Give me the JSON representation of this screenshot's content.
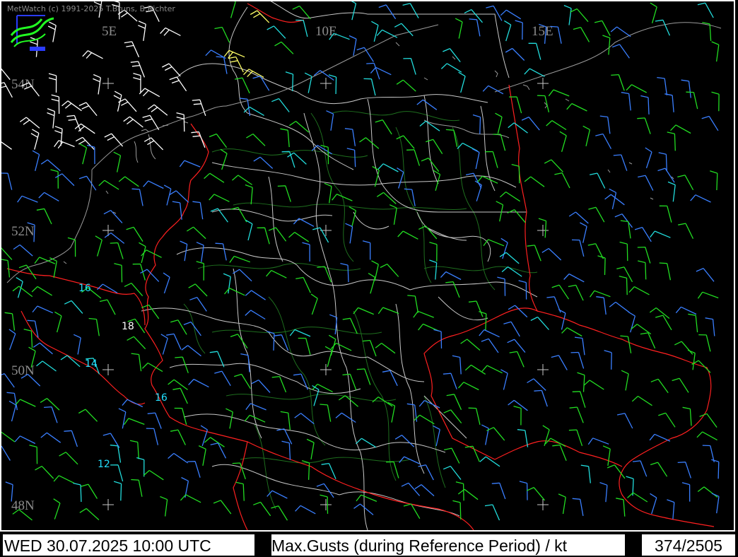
{
  "credit": "MetWatch  (c) 1991-2025 T.Bruns, B.Richter",
  "footer": {
    "datetime": "WED 30.07.2025 10:00 UTC",
    "description": "Max.Gusts (during Reference Period) / kt",
    "counter": "374/2505"
  },
  "grid": {
    "lon_labels": [
      "5E",
      "10E",
      "15E"
    ],
    "lat_labels": [
      "54N",
      "52N",
      "50N",
      "48N"
    ]
  },
  "gust_values": [
    {
      "text": "16",
      "color": "#22e0ff"
    },
    {
      "text": "18",
      "color": "#ffffff"
    },
    {
      "text": "14",
      "color": "#22e0ff"
    },
    {
      "text": "16",
      "color": "#22e0ff"
    },
    {
      "text": "12",
      "color": "#22e0ff"
    }
  ],
  "colors": {
    "border_country": "#ff2020",
    "border_state": "#c8c8c8",
    "border_district": "#1e7a1e",
    "barb_green": "#22dd22",
    "barb_blue": "#3a7fff",
    "barb_cyan": "#22dddd",
    "barb_white": "#ffffff",
    "barb_yellow": "#ffff66"
  },
  "icons": [
    "metwatch-logo-icon"
  ]
}
